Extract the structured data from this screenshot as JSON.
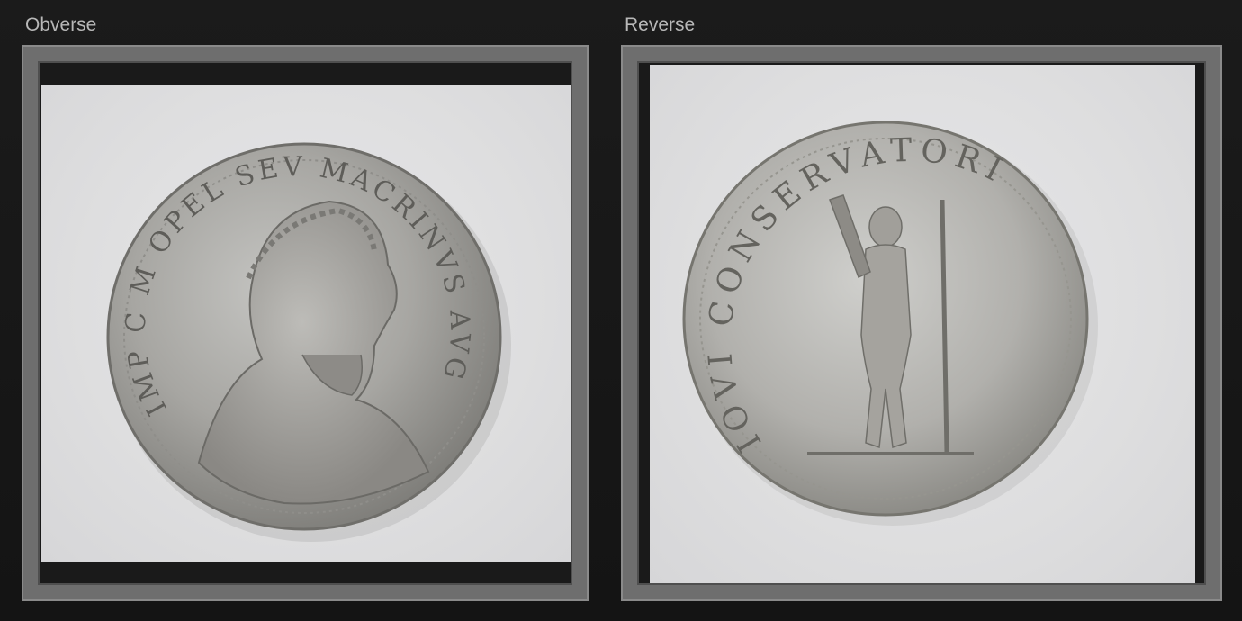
{
  "panels": {
    "obverse": {
      "label": "Obverse",
      "legend": "IMP C M OPEL SEV MACRINVS AVG"
    },
    "reverse": {
      "label": "Reverse",
      "legend": "IOVI CONSERVATORI"
    }
  },
  "colors": {
    "background": "#161616",
    "frame": "#6e6e6e",
    "photo_background": "#dedee0",
    "coin_silver": "#a8a8a6"
  }
}
